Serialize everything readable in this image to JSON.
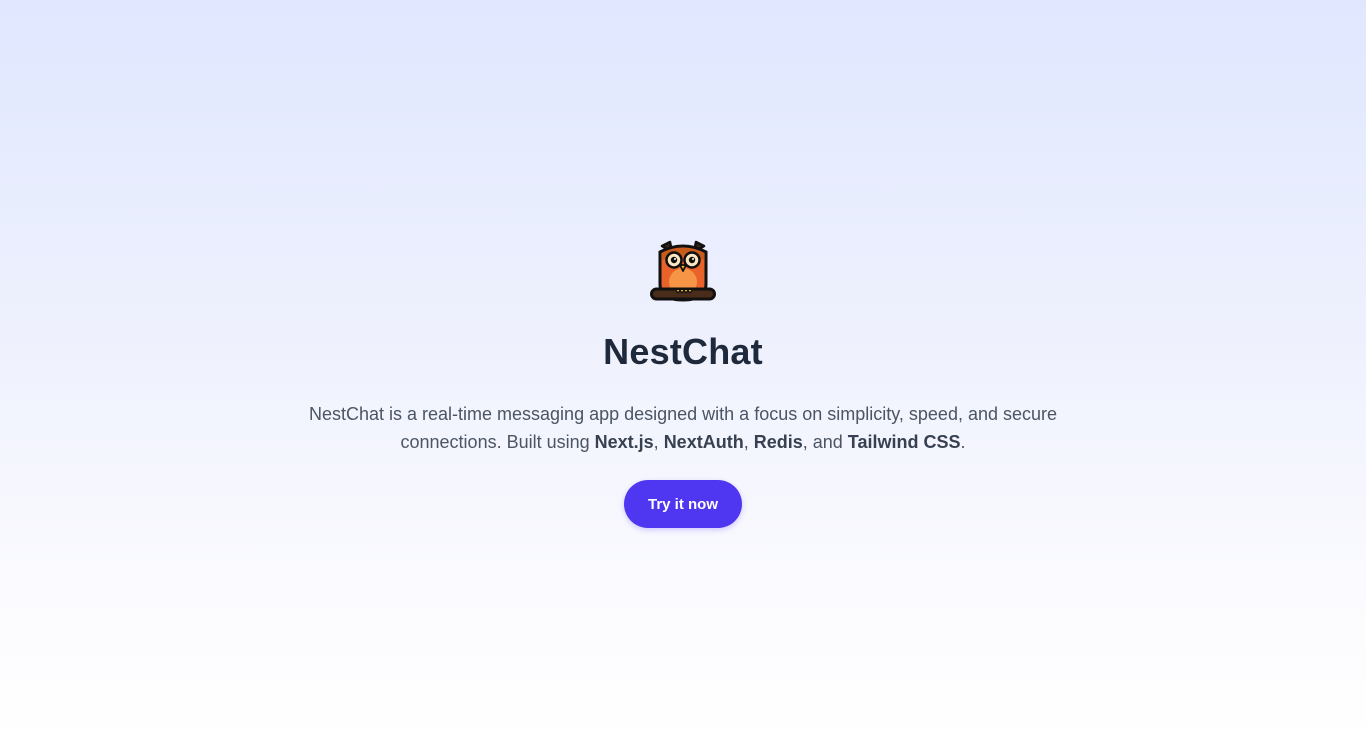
{
  "hero": {
    "logo_icon": "owl-icon",
    "title": "NestChat",
    "description": {
      "intro": "NestChat is a real-time messaging app designed with a focus on simplicity, speed, and secure connections. Built using ",
      "tech1": "Next.js",
      "sep1": ", ",
      "tech2": "NextAuth",
      "sep2": ", ",
      "tech3": "Redis",
      "sep3": ", and ",
      "tech4": "Tailwind CSS",
      "end": "."
    },
    "cta_label": "Try it now"
  },
  "colors": {
    "accent": "#4f36f0",
    "title": "#1e293b",
    "text": "#4b5563",
    "background_top": "#e0e7ff",
    "background_bottom": "#ffffff"
  }
}
